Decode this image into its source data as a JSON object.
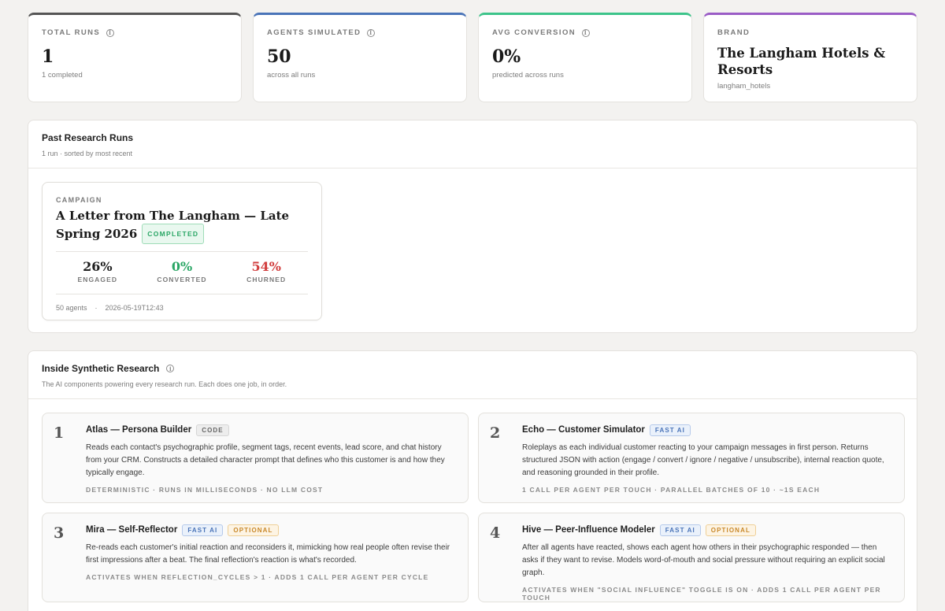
{
  "stats": [
    {
      "label": "TOTAL RUNS",
      "value": "1",
      "sub": "1 completed",
      "accent": "#555555",
      "info": true
    },
    {
      "label": "AGENTS SIMULATED",
      "value": "50",
      "sub": "across all runs",
      "accent": "#4a74b8",
      "info": true
    },
    {
      "label": "AVG CONVERSION",
      "value": "0%",
      "sub": "predicted across runs",
      "accent": "#3cc48a",
      "info": true
    },
    {
      "label": "BRAND",
      "value": "The Langham Hotels & Resorts",
      "sub": "langham_hotels",
      "accent": "#9a5cc6",
      "info": false
    }
  ],
  "past_runs": {
    "title": "Past Research Runs",
    "subtitle": "1 run · sorted by most recent",
    "runs": [
      {
        "caption": "CAMPAIGN",
        "title": "A Letter from The Langham — Late Spring 2026",
        "status": "COMPLETED",
        "metrics": [
          {
            "value": "26%",
            "label": "ENGAGED",
            "color": "#1f1f1f"
          },
          {
            "value": "0%",
            "label": "CONVERTED",
            "color": "#2aa665"
          },
          {
            "value": "54%",
            "label": "CHURNED",
            "color": "#d13c3c"
          }
        ],
        "agents": "50 agents",
        "separator": "·",
        "timestamp": "2026-05-19T12:43"
      }
    ]
  },
  "inside": {
    "title": "Inside Synthetic Research",
    "subtitle": "The AI components powering every research run. Each does one job, in order.",
    "components": [
      {
        "num": "1",
        "name": "Atlas — Persona Builder",
        "tags": [
          {
            "text": "CODE",
            "kind": "code"
          }
        ],
        "desc": "Reads each contact's psychographic profile, segment tags, recent events, lead score, and chat history from your CRM. Constructs a detailed character prompt that defines who this customer is and how they typically engage.",
        "foot": "DETERMINISTIC · RUNS IN MILLISECONDS · NO LLM COST"
      },
      {
        "num": "2",
        "name": "Echo — Customer Simulator",
        "tags": [
          {
            "text": "FAST AI",
            "kind": "fast"
          }
        ],
        "desc": "Roleplays as each individual customer reacting to your campaign messages in first person. Returns structured JSON with action (engage / convert / ignore / negative / unsubscribe), internal reaction quote, and reasoning grounded in their profile.",
        "foot": "1 CALL PER AGENT PER TOUCH · PARALLEL BATCHES OF 10 · ~1S EACH"
      },
      {
        "num": "3",
        "name": "Mira — Self-Reflector",
        "tags": [
          {
            "text": "FAST AI",
            "kind": "fast"
          },
          {
            "text": "OPTIONAL",
            "kind": "opt"
          }
        ],
        "desc": "Re-reads each customer's initial reaction and reconsiders it, mimicking how real people often revise their first impressions after a beat. The final reflection's reaction is what's recorded.",
        "foot": "ACTIVATES WHEN REFLECTION_CYCLES > 1 · ADDS 1 CALL PER AGENT PER CYCLE"
      },
      {
        "num": "4",
        "name": "Hive — Peer-Influence Modeler",
        "tags": [
          {
            "text": "FAST AI",
            "kind": "fast"
          },
          {
            "text": "OPTIONAL",
            "kind": "opt"
          }
        ],
        "desc": "After all agents have reacted, shows each agent how others in their psychographic responded — then asks if they want to revise. Models word-of-mouth and social pressure without requiring an explicit social graph.",
        "foot": "ACTIVATES WHEN \"SOCIAL INFLUENCE\" TOGGLE IS ON · ADDS 1 CALL PER AGENT PER TOUCH"
      }
    ]
  }
}
